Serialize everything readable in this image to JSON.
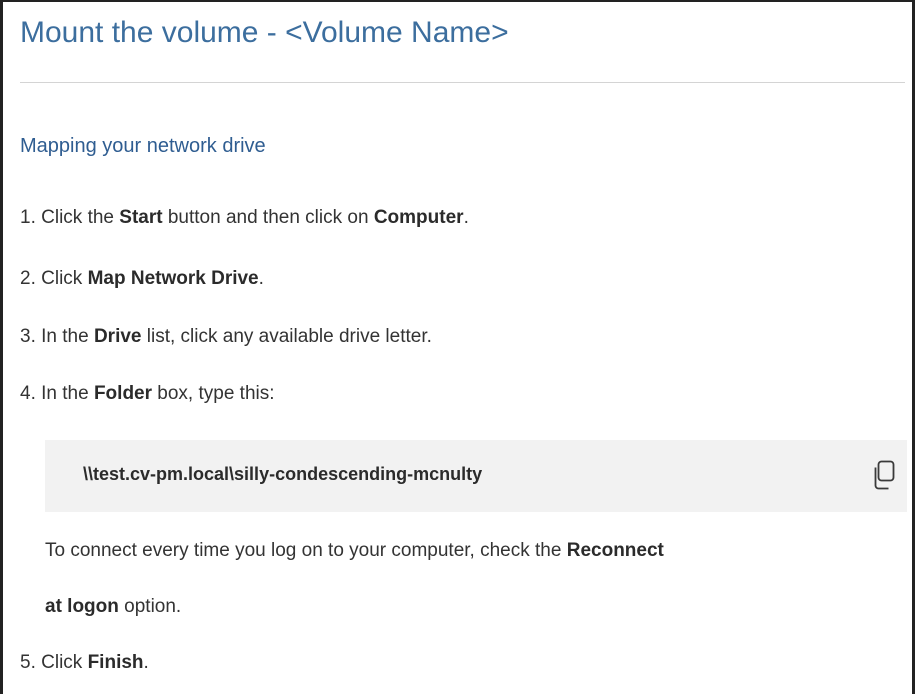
{
  "dialog": {
    "title": "Mount the volume - <Volume Name>",
    "subtitle": "Mapping your network drive"
  },
  "steps": [
    {
      "prefix": "1. Click the ",
      "b1": "Start",
      "mid": " button and then click on ",
      "b2": "Computer",
      "suffix": "."
    },
    {
      "prefix": "2. Click ",
      "b1": "Map Network Drive",
      "suffix": "."
    },
    {
      "prefix": "3. In the ",
      "b1": "Drive",
      "suffix": " list, click any available drive letter."
    },
    {
      "prefix": "4. In the ",
      "b1": "Folder",
      "suffix": " box, type this:"
    },
    {
      "prefix": "5. Click ",
      "b1": "Finish",
      "suffix": "."
    }
  ],
  "path_box": {
    "path": "\\\\test.cv-pm.local\\silly-condescending-mcnulty",
    "copy_icon": "copy-icon"
  },
  "note": {
    "line1_prefix": "To connect every time you log on to your computer, check the ",
    "line1_bold": "Reconnect",
    "line2_bold": "at logon",
    "line2_suffix": " option."
  },
  "colors": {
    "title": "#3c6e9e",
    "subtitle": "#2f5d91",
    "text": "#333333",
    "path_box_bg": "#f2f2f2"
  }
}
